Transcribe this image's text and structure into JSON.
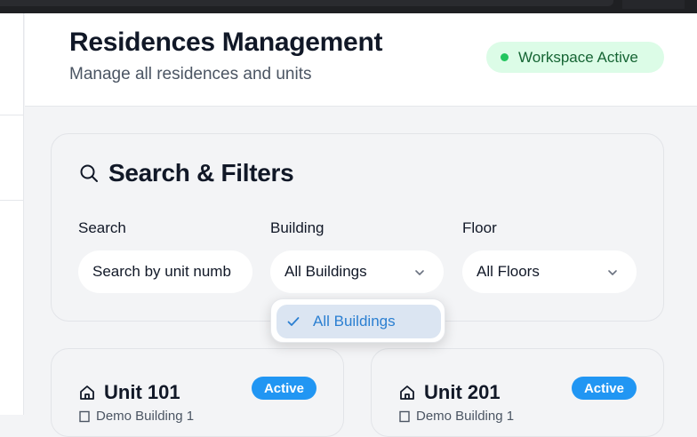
{
  "header": {
    "title": "Residences Management",
    "subtitle": "Manage all residences and units",
    "workspace_badge": "Workspace Active"
  },
  "filters": {
    "title": "Search & Filters",
    "search": {
      "label": "Search",
      "placeholder": "Search by unit numb"
    },
    "building": {
      "label": "Building",
      "value": "All Buildings"
    },
    "floor": {
      "label": "Floor",
      "value": "All Floors"
    }
  },
  "building_dropdown": {
    "options": [
      {
        "label": "All Buildings",
        "selected": true
      }
    ]
  },
  "units": [
    {
      "title": "Unit 101",
      "status": "Active",
      "building": "Demo Building 1"
    },
    {
      "title": "Unit 201",
      "status": "Active",
      "building": "Demo Building 1"
    }
  ],
  "colors": {
    "accent": "#2196f3",
    "status_active": "#22c55e",
    "badge_bg": "#dcfce7",
    "dropdown_selected_bg": "#dbe5f2"
  },
  "icons": {
    "filters_title": "search-icon",
    "building_chevron": "chevron-down-icon",
    "floor_chevron": "chevron-down-icon",
    "dropdown_selected": "check-icon",
    "unit": "home-icon",
    "unit_building": "building-icon"
  }
}
